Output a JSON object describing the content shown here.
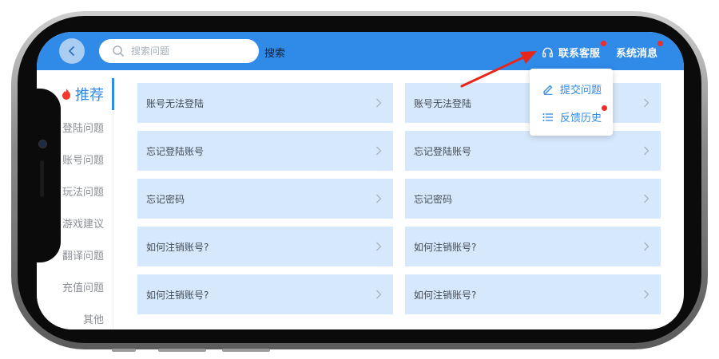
{
  "header": {
    "search_placeholder": "搜索问题",
    "search_button": "搜索",
    "customer_service": "联系客服",
    "system_messages": "系统消息"
  },
  "sidebar": {
    "active_item": "推荐",
    "items": [
      "登陆问题",
      "账号问题",
      "玩法问题",
      "游戏建议",
      "翻译问题",
      "充值问题",
      "其他"
    ]
  },
  "faq_items": [
    "账号无法登陆",
    "账号无法登陆",
    "忘记登陆账号",
    "忘记登陆账号",
    "忘记密码",
    "忘记密码",
    "如何注销账号?",
    "如何注销账号?",
    "如何注销账号?",
    "如何注销账号?"
  ],
  "dropdown": {
    "submit_issue": "提交问题",
    "feedback_history": "反馈历史"
  },
  "colors": {
    "primary": "#2f8ae8",
    "card_bg": "#d6e8fb",
    "notification_dot": "#f22b2b",
    "annotation_arrow": "#e8271c"
  },
  "icons": {
    "back": "chevron-left-icon",
    "search": "search-icon",
    "customer_service": "headset-icon",
    "hot": "flame-icon",
    "submit": "pencil-icon",
    "history": "list-icon",
    "card": "chevron-right-icon"
  }
}
